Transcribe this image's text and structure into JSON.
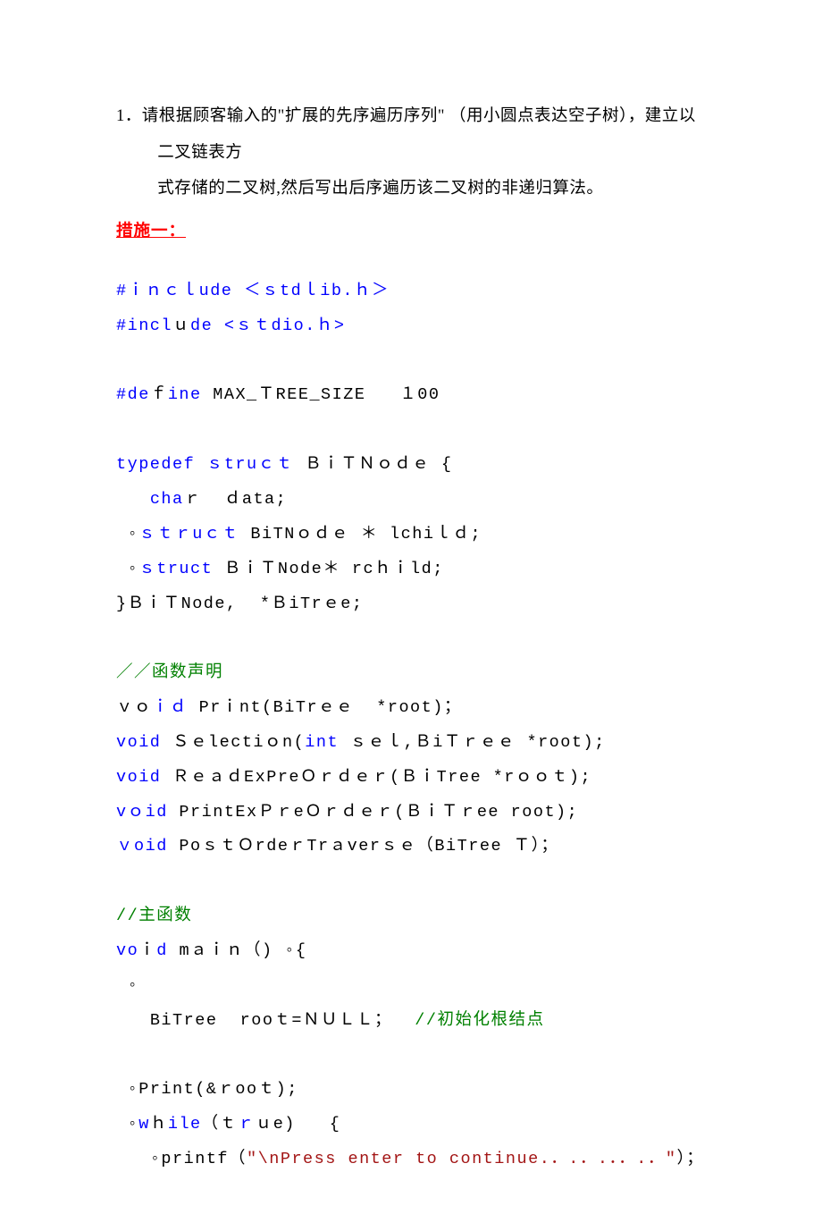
{
  "question": {
    "number": "1．",
    "text_line1": "请根据顾客输入的\"扩展的先序遍历序列\" （用小圆点表达空子树），建立以二叉链表方",
    "text_line2": "式存储的二叉树,然后写出后序遍历该二叉树的非递归算法。"
  },
  "method_label": "措施一：",
  "code": {
    "l1_a": "#ｉｎｃｌude ＜ｓtdｌib.ｈ＞",
    "l2_a": "#incl",
    "l2_b": "ｕ",
    "l2_c": "de <ｓｔdio.ｈ>",
    "l3_a": "#de",
    "l3_b": "ｆ",
    "l3_c": "ine",
    "l3_d": " MAX_ＴREE_SIZE   １00",
    "l4_a": "typedef",
    "l4_b": " ｓtruｃｔ",
    "l4_c": " ＢｉＴＮｏｄｅ {",
    "l5_a": "   cha",
    "l5_b": "ｒ",
    "l5_c": "  ｄata;",
    "l6_a": "ｓｔｒuｃｔ",
    "l6_b": " BiTNｏｄｅ ＊ lchiｌｄ;",
    "l7_a": "ｓtruct",
    "l7_b": " ＢｉＴNode＊ rcｈｉld;",
    "l8": "}ＢｉＴNode,  *ＢiTrｅe;",
    "l9": "／／函数声明",
    "l10_a": "ｖｏ",
    "l10_b": "ｉｄ",
    "l10_c": " Prｉnt(BiTrｅｅ  *root)；",
    "l11_a": "void",
    "l11_b": " Ｓｅlectiｏn(",
    "l11_c": "int",
    "l11_d": " ｓｅｌ,ＢiＴｒｅｅ *root);",
    "l12_a": "void",
    "l12_b": " ＲｅａｄExPreＯｒｄｅｒ(ＢｉTree *rｏｏｔ);",
    "l13_a": "vｏid",
    "l13_b": " PrintExＰｒeＯｒｄｅｒ(ＢｉＴｒee root);",
    "l14_a": "ｖoid",
    "l14_b": " PoｓｔＯrdeｒTrａverｓｅ（BiTree Ｔ）；",
    "l15": "//主函数",
    "l16_a": "vo",
    "l16_b": "ｉ",
    "l16_c": "d",
    "l16_d": " mａｉｎ（)",
    "l17": "{",
    "l18_a": "   BiTree  rooｔ=ＮＵＬＬ；  ",
    "l18_b": "//初始化根结点",
    "l19": "Print(&ｒooｔ);",
    "l20_a": "w",
    "l20_b": "ｈ",
    "l20_c": "ile",
    "l20_d": "（ｔ",
    "l20_e": "ｒ",
    "l20_f": "ｕe)   {",
    "l21_a": "printf（",
    "l21_b": "\"\\nPress enter to continue.．.．.．．.．\"",
    "l21_c": "）；"
  }
}
